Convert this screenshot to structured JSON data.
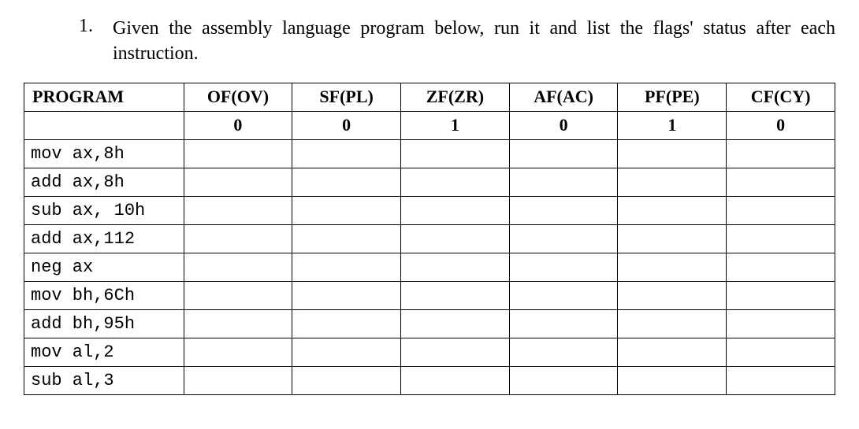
{
  "question": {
    "number": "1.",
    "text": "Given the assembly language program below, run it and list the flags' status after each instruction."
  },
  "table": {
    "headers": {
      "program": "PROGRAM",
      "of": "OF(OV)",
      "sf": "SF(PL)",
      "zf": "ZF(ZR)",
      "af": "AF(AC)",
      "pf": "PF(PE)",
      "cf": "CF(CY)"
    },
    "rows": [
      {
        "program": "",
        "of": "0",
        "sf": "0",
        "zf": "1",
        "af": "0",
        "pf": "1",
        "cf": "0"
      },
      {
        "program": "mov ax,8h",
        "of": "",
        "sf": "",
        "zf": "",
        "af": "",
        "pf": "",
        "cf": ""
      },
      {
        "program": "add ax,8h",
        "of": "",
        "sf": "",
        "zf": "",
        "af": "",
        "pf": "",
        "cf": ""
      },
      {
        "program": "sub ax, 10h",
        "of": "",
        "sf": "",
        "zf": "",
        "af": "",
        "pf": "",
        "cf": ""
      },
      {
        "program": "add ax,112",
        "of": "",
        "sf": "",
        "zf": "",
        "af": "",
        "pf": "",
        "cf": ""
      },
      {
        "program": "neg ax",
        "of": "",
        "sf": "",
        "zf": "",
        "af": "",
        "pf": "",
        "cf": ""
      },
      {
        "program": "mov bh,6Ch",
        "of": "",
        "sf": "",
        "zf": "",
        "af": "",
        "pf": "",
        "cf": ""
      },
      {
        "program": "add bh,95h",
        "of": "",
        "sf": "",
        "zf": "",
        "af": "",
        "pf": "",
        "cf": ""
      },
      {
        "program": "mov al,2",
        "of": "",
        "sf": "",
        "zf": "",
        "af": "",
        "pf": "",
        "cf": ""
      },
      {
        "program": "sub al,3",
        "of": "",
        "sf": "",
        "zf": "",
        "af": "",
        "pf": "",
        "cf": ""
      }
    ]
  }
}
